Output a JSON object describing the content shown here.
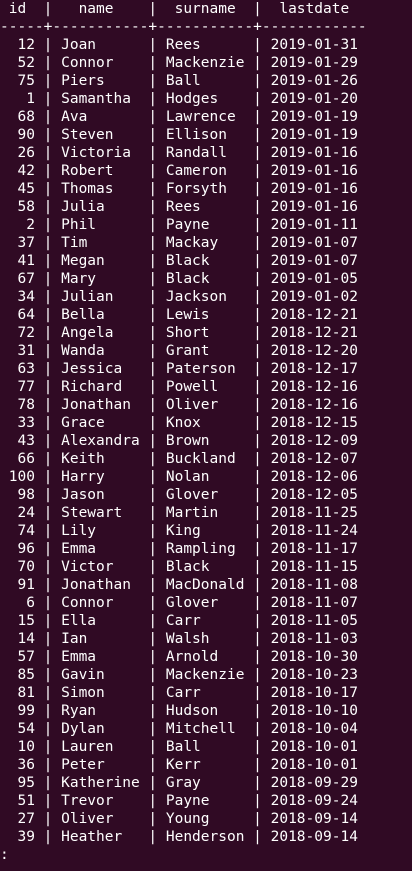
{
  "terminal": {
    "header_line": " id  |   name    |  surname  |  lastdate",
    "separator_line": "-----+-----------+-----------+------------",
    "rows": [
      "  12 | Joan      | Rees      | 2019-01-31",
      "  52 | Connor    | Mackenzie | 2019-01-29",
      "  75 | Piers     | Ball      | 2019-01-26",
      "   1 | Samantha  | Hodges    | 2019-01-20",
      "  68 | Ava       | Lawrence  | 2019-01-19",
      "  90 | Steven    | Ellison   | 2019-01-19",
      "  26 | Victoria  | Randall   | 2019-01-16",
      "  42 | Robert    | Cameron   | 2019-01-16",
      "  45 | Thomas    | Forsyth   | 2019-01-16",
      "  58 | Julia     | Rees      | 2019-01-16",
      "   2 | Phil      | Payne     | 2019-01-11",
      "  37 | Tim       | Mackay    | 2019-01-07",
      "  41 | Megan     | Black     | 2019-01-07",
      "  67 | Mary      | Black     | 2019-01-05",
      "  34 | Julian    | Jackson   | 2019-01-02",
      "  64 | Bella     | Lewis     | 2018-12-21",
      "  72 | Angela    | Short     | 2018-12-21",
      "  31 | Wanda     | Grant     | 2018-12-20",
      "  63 | Jessica   | Paterson  | 2018-12-17",
      "  77 | Richard   | Powell    | 2018-12-16",
      "  78 | Jonathan  | Oliver    | 2018-12-16",
      "  33 | Grace     | Knox      | 2018-12-15",
      "  43 | Alexandra | Brown     | 2018-12-09",
      "  66 | Keith     | Buckland  | 2018-12-07",
      " 100 | Harry     | Nolan     | 2018-12-06",
      "  98 | Jason     | Glover    | 2018-12-05",
      "  24 | Stewart   | Martin    | 2018-11-25",
      "  74 | Lily      | King      | 2018-11-24",
      "  96 | Emma      | Rampling  | 2018-11-17",
      "  70 | Victor    | Black     | 2018-11-15",
      "  91 | Jonathan  | MacDonald | 2018-11-08",
      "   6 | Connor    | Glover    | 2018-11-07",
      "  15 | Ella      | Carr      | 2018-11-05",
      "  14 | Ian       | Walsh     | 2018-11-03",
      "  57 | Emma      | Arnold    | 2018-10-30",
      "  85 | Gavin     | Mackenzie | 2018-10-23",
      "  81 | Simon     | Carr      | 2018-10-17",
      "  99 | Ryan      | Hudson    | 2018-10-10",
      "  54 | Dylan     | Mitchell  | 2018-10-04",
      "  10 | Lauren    | Ball      | 2018-10-01",
      "  36 | Peter     | Kerr      | 2018-10-01",
      "  95 | Katherine | Gray      | 2018-09-29",
      "  51 | Trevor    | Payne     | 2018-09-24",
      "  27 | Oliver    | Young     | 2018-09-14",
      "  39 | Heather   | Henderson | 2018-09-14"
    ],
    "prompt": ":"
  }
}
